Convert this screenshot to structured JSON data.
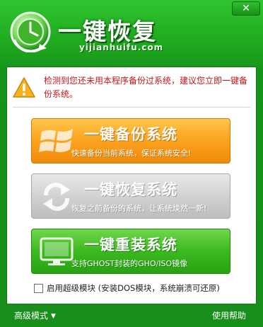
{
  "window": {
    "title": "一键恢复",
    "subtitle": "yijianhuifu.com",
    "close_label": "✕"
  },
  "warning": {
    "icon": "warning-triangle-icon",
    "text": "检测到您还未用本程序备份过系统，建议您立即一键备份系统。"
  },
  "actions": [
    {
      "label": "一键备份系统",
      "desc": "快速备份当前系统，保证系统安全!",
      "icon": "windows-logo-icon",
      "color": "#f8a21c"
    },
    {
      "label": "一键恢复系统",
      "desc": "恢复之前备份的系统，让系统焕然一新!",
      "icon": "refresh-arrows-icon",
      "color": "#cfcfcf"
    },
    {
      "label": "一键重装系统",
      "desc": "支持GHOST封装的GHO/ISO镜像",
      "icon": "monitor-icon",
      "color": "#3cb81f"
    }
  ],
  "advanced": {
    "checkbox_label": "启用超级模块 (安装DOS模块，系统崩溃可还原)",
    "checked": false
  },
  "footer": {
    "mode_label": "高级模式",
    "help_label": "使用帮助"
  },
  "colors": {
    "frame": "#1ea81e",
    "warning_text": "#c7151a"
  }
}
